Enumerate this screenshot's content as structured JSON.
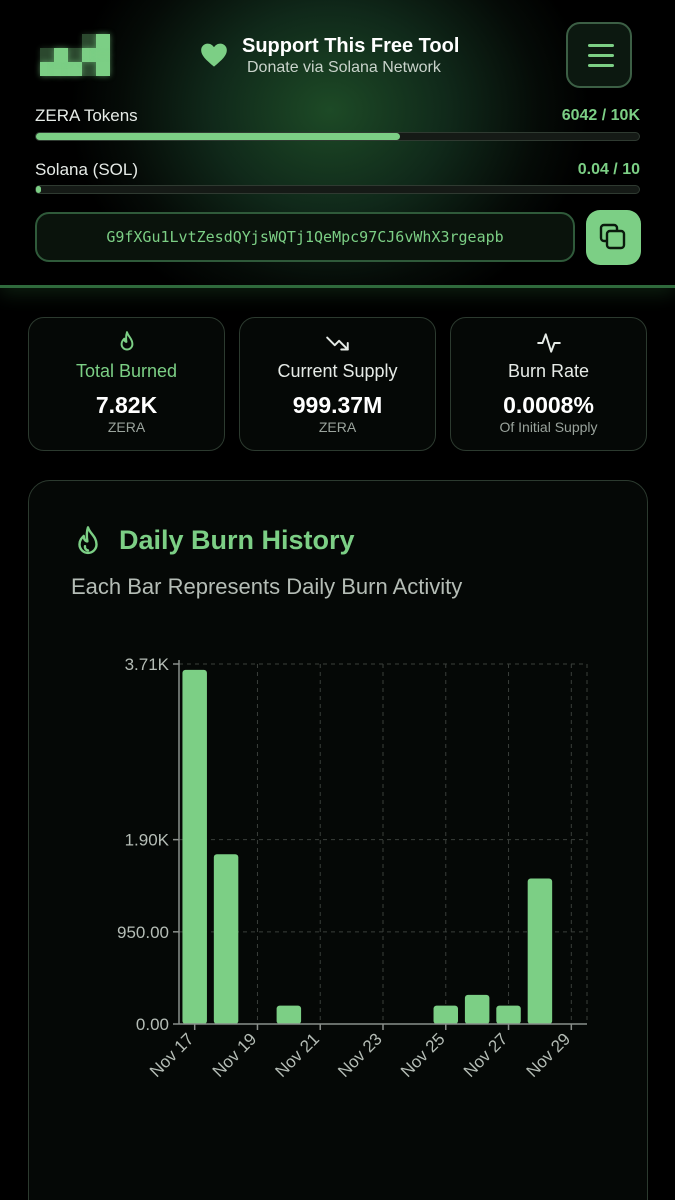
{
  "header": {
    "support_title": "Support This Free Tool",
    "support_subtitle": "Donate via Solana Network",
    "logo_icon": "checker-pixel-logo",
    "heart_icon": "heart-icon",
    "menu_icon": "hamburger-menu-icon"
  },
  "progress": [
    {
      "label": "ZERA Tokens",
      "value_text": "6042 / 10K",
      "fraction": 0.6042
    },
    {
      "label": "Solana (SOL)",
      "value_text": "0.04 / 10",
      "fraction": 0.004
    }
  ],
  "wallet": {
    "address": "G9fXGu1LvtZesdQYjsWQTj1QeMpc97CJ6vWhX3rgeapb",
    "copy_icon": "copy-icon"
  },
  "stats": [
    {
      "icon": "flame-icon",
      "label": "Total Burned",
      "value": "7.82K",
      "unit": "ZERA",
      "label_color": "#7ccf85"
    },
    {
      "icon": "trending-down-icon",
      "label": "Current Supply",
      "value": "999.37M",
      "unit": "ZERA",
      "label_color": "#e6ebe7"
    },
    {
      "icon": "activity-icon",
      "label": "Burn Rate",
      "value": "0.0008%",
      "unit": "Of Initial Supply",
      "label_color": "#e6ebe7"
    }
  ],
  "chart_card": {
    "title": "Daily Burn History",
    "subtitle": "Each Bar Represents Daily Burn Activity",
    "icon": "flame-icon"
  },
  "chart_data": {
    "type": "bar",
    "title": "Daily Burn History",
    "categories": [
      "Nov 17",
      "Nov 18",
      "Nov 19",
      "Nov 20",
      "Nov 21",
      "Nov 22",
      "Nov 23",
      "Nov 24",
      "Nov 25",
      "Nov 26",
      "Nov 27",
      "Nov 28",
      "Nov 29"
    ],
    "values": [
      3650,
      1750,
      0,
      190,
      0,
      0,
      0,
      0,
      190,
      300,
      190,
      1500,
      0
    ],
    "x_tick_labels": [
      "Nov 17",
      "Nov 19",
      "Nov 21",
      "Nov 23",
      "Nov 25",
      "Nov 27",
      "Nov 29"
    ],
    "y_ticks": [
      0,
      950,
      1900,
      3710
    ],
    "y_tick_labels": [
      "0.00",
      "950.00",
      "1.90K",
      "3.71K"
    ],
    "ylim": [
      0,
      3710
    ],
    "grid": true,
    "bar_color": "#7ccf85"
  }
}
